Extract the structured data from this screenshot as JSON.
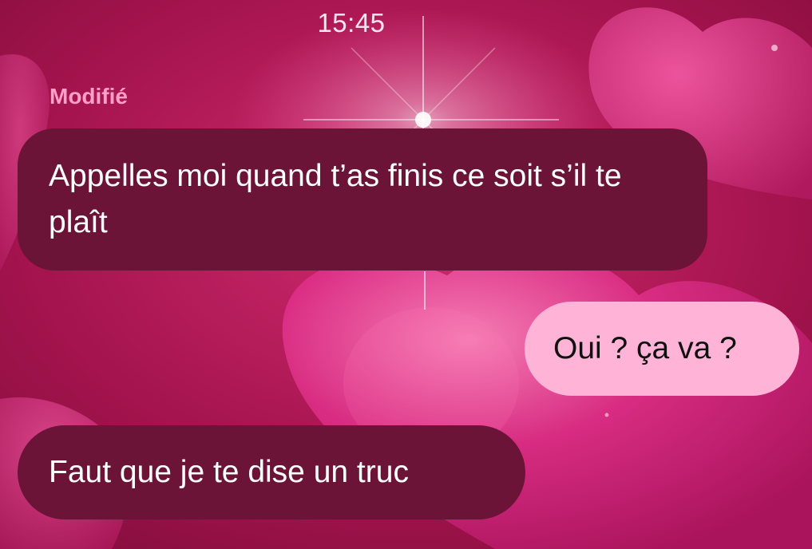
{
  "status": {
    "time": "15:45"
  },
  "conversation": {
    "edited_label": "Modifié",
    "messages": [
      {
        "direction": "received",
        "text": "Appelles moi quand t’as finis ce soit s’il te plaît"
      },
      {
        "direction": "sent",
        "text": "Oui ? ça va ?"
      },
      {
        "direction": "received",
        "text": "Faut que je te dise un truc"
      }
    ]
  },
  "theme": {
    "wallpaper": "pink hearts with sparkle",
    "received_bubble_color": "#6b1437",
    "sent_bubble_color": "#ffb4d7",
    "edited_label_color": "#ff9fc9"
  }
}
